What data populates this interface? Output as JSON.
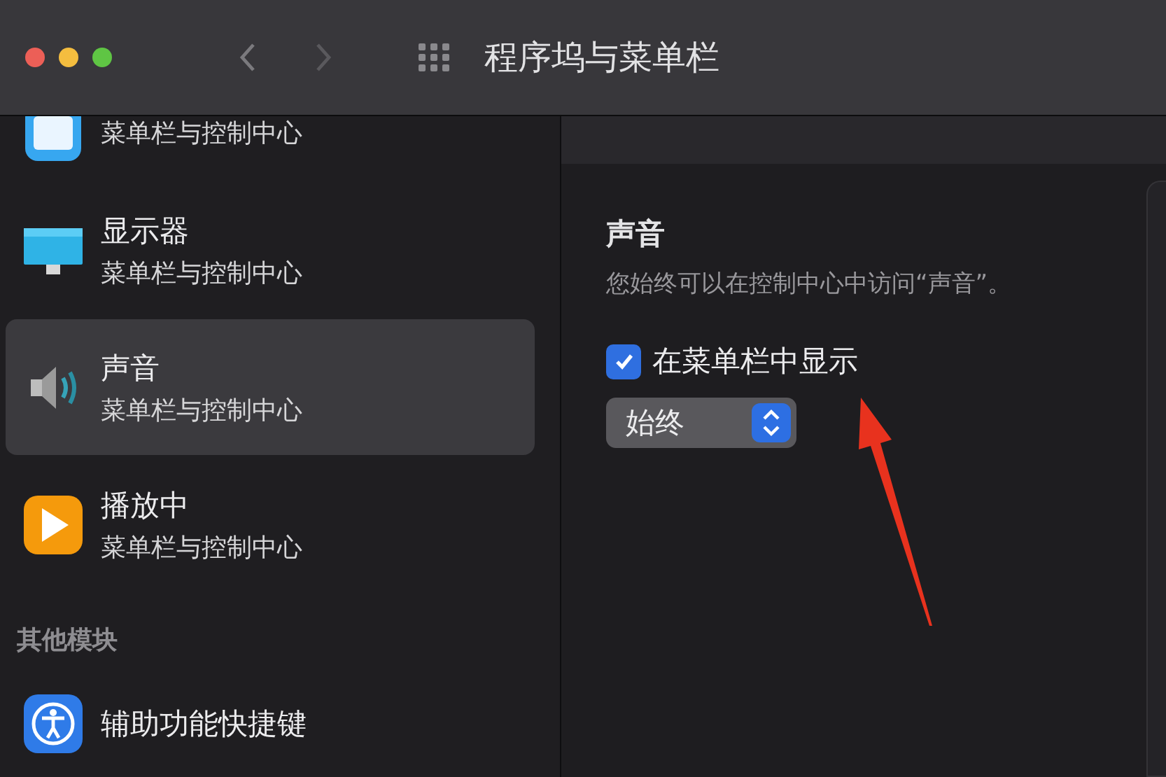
{
  "window": {
    "title": "程序坞与菜单栏"
  },
  "sidebar": {
    "items": [
      {
        "kind": "menubar",
        "subtitle": "菜单栏与控制中心",
        "selected": false
      },
      {
        "kind": "display",
        "title": "显示器",
        "subtitle": "菜单栏与控制中心",
        "selected": false
      },
      {
        "kind": "sound",
        "title": "声音",
        "subtitle": "菜单栏与控制中心",
        "selected": true
      },
      {
        "kind": "nowplaying",
        "title": "播放中",
        "subtitle": "菜单栏与控制中心",
        "selected": false
      }
    ],
    "section": {
      "heading": "其他模块",
      "items": [
        {
          "kind": "accessibility",
          "title": "辅助功能快捷键",
          "selected": false
        }
      ]
    }
  },
  "detail": {
    "heading": "声音",
    "description": "您始终可以在控制中心中访问“声音”。",
    "checkbox": {
      "label": "在菜单栏中显示",
      "checked": true
    },
    "popup": {
      "value": "始终"
    }
  }
}
